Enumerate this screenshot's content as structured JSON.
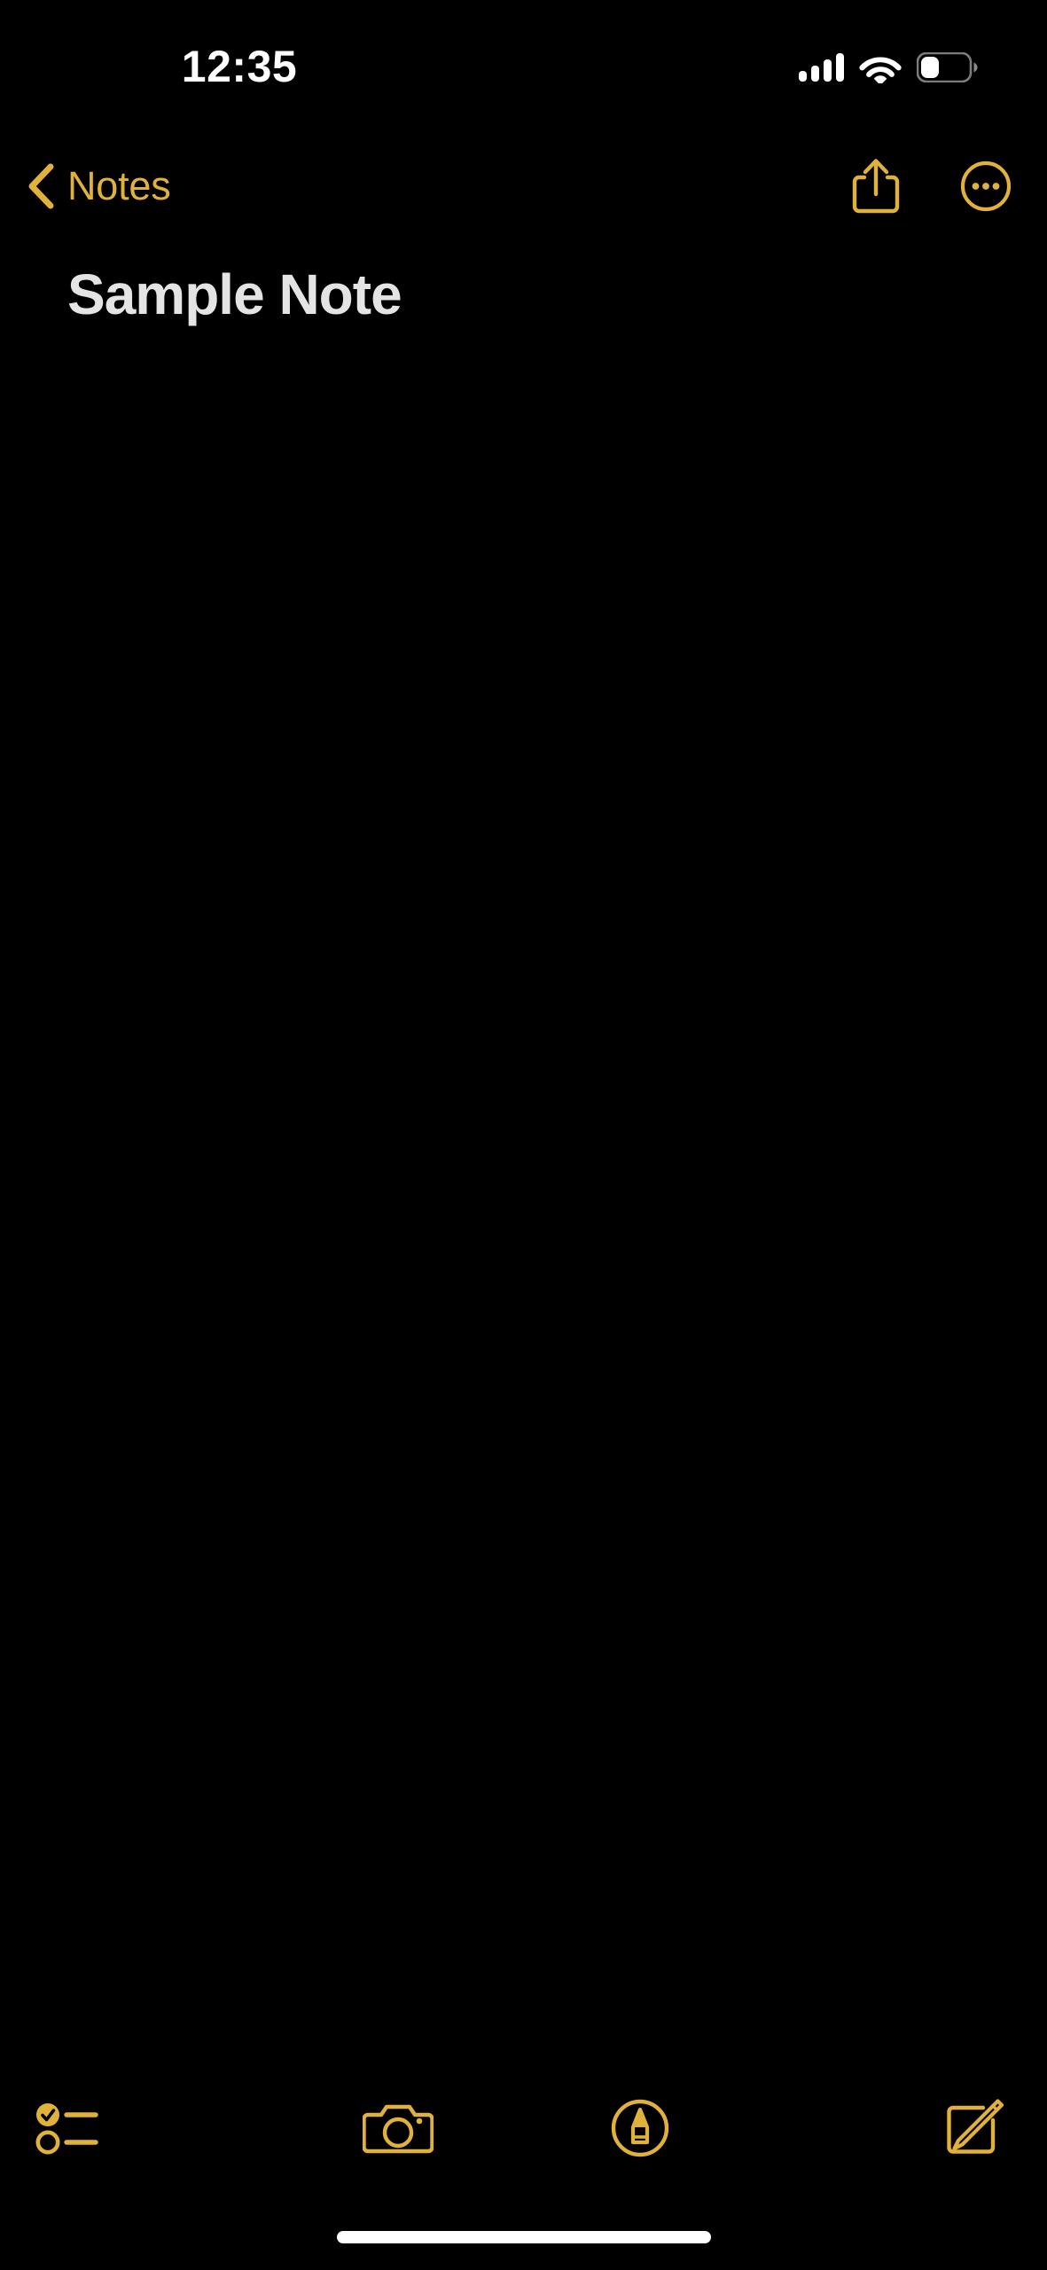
{
  "theme": {
    "background": "#000000",
    "accent": "#e0b13b",
    "text_primary": "#e4e4e4",
    "status_icon_color": "#ffffff"
  },
  "status_bar": {
    "time": "12:35",
    "cellular": {
      "icon": "cellular-signal-icon",
      "bars_total": 4,
      "bars_filled": 4
    },
    "wifi": {
      "icon": "wifi-icon",
      "level": 3
    },
    "battery": {
      "icon": "battery-icon",
      "percent": 35
    }
  },
  "nav_bar": {
    "back": {
      "icon": "chevron-left-icon",
      "label": "Notes"
    },
    "actions": [
      {
        "icon": "share-icon",
        "name": "share-button"
      },
      {
        "icon": "more-circle-icon",
        "name": "more-options-button"
      }
    ]
  },
  "note": {
    "title": "Sample Note",
    "body": "",
    "placeholder": ""
  },
  "toolbar": {
    "items": [
      {
        "icon": "checklist-icon",
        "name": "checklist-button"
      },
      {
        "icon": "camera-icon",
        "name": "camera-button"
      },
      {
        "icon": "markup-pen-icon",
        "name": "markup-button"
      },
      {
        "icon": "compose-icon",
        "name": "compose-button"
      }
    ]
  },
  "home_indicator": {
    "name": "home-indicator"
  }
}
